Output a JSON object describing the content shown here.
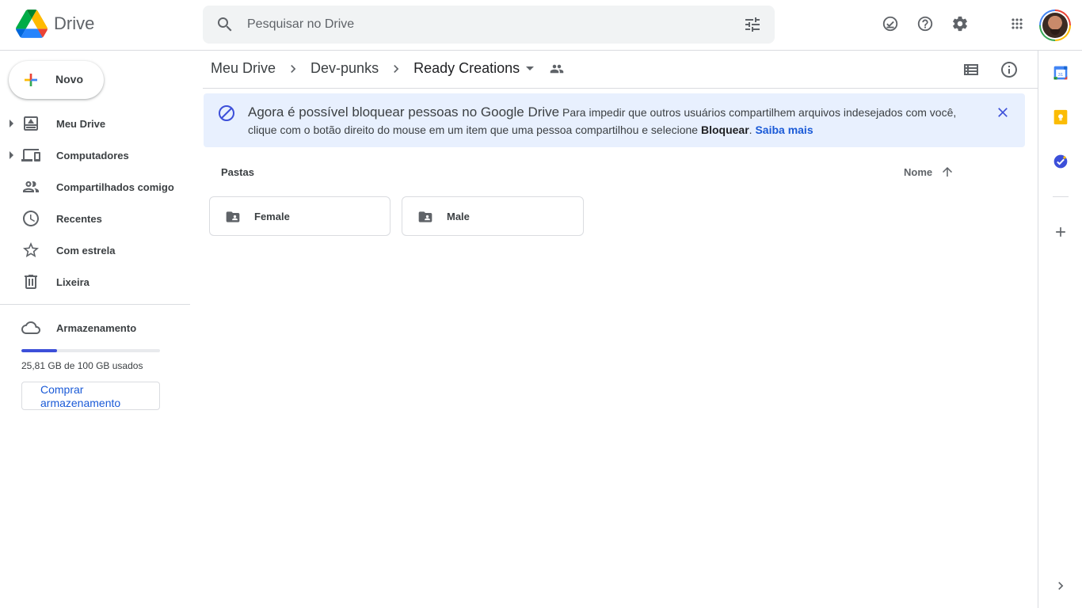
{
  "app": {
    "name": "Drive"
  },
  "search": {
    "placeholder": "Pesquisar no Drive"
  },
  "header_icons": [
    "ready-for-offline-icon",
    "help-icon",
    "settings-icon",
    "apps-grid-icon"
  ],
  "sidebar": {
    "new_button": "Novo",
    "items": [
      {
        "label": "Meu Drive",
        "icon": "my-drive-icon",
        "expandable": true
      },
      {
        "label": "Computadores",
        "icon": "computers-icon",
        "expandable": true
      },
      {
        "label": "Compartilhados comigo",
        "icon": "shared-with-me-icon",
        "expandable": false
      },
      {
        "label": "Recentes",
        "icon": "recent-icon",
        "expandable": false
      },
      {
        "label": "Com estrela",
        "icon": "star-icon",
        "expandable": false
      },
      {
        "label": "Lixeira",
        "icon": "trash-icon",
        "expandable": false
      }
    ],
    "storage": {
      "label": "Armazenamento",
      "used_text": "25,81 GB de 100 GB usados",
      "used_fraction": 0.2581,
      "buy_button": "Comprar armazenamento",
      "bar_color": "#3c4fd9"
    }
  },
  "breadcrumb": {
    "items": [
      "Meu Drive",
      "Dev-punks"
    ],
    "current": "Ready Creations"
  },
  "banner": {
    "title": "Agora é possível bloquear pessoas no Google Drive",
    "body": "Para impedir que outros usuários compartilhem arquivos indesejados com você, clique com o botão direito do mouse em um item que uma pessoa compartilhou e selecione",
    "strong": "Bloquear",
    "period": ".",
    "link": "Saiba mais"
  },
  "content": {
    "section_title": "Pastas",
    "sort_label": "Nome",
    "folders": [
      {
        "name": "Female",
        "icon": "shared-folder-icon"
      },
      {
        "name": "Male",
        "icon": "shared-folder-icon"
      }
    ]
  },
  "right_rail": {
    "apps": [
      "calendar-icon",
      "keep-icon",
      "tasks-icon"
    ],
    "calendar_day": "31"
  },
  "colors": {
    "accent": "#1a5ad7",
    "banner_bg": "#e8f0fe",
    "keep": "#fbbc04",
    "tasks": "#3c4fd9"
  }
}
